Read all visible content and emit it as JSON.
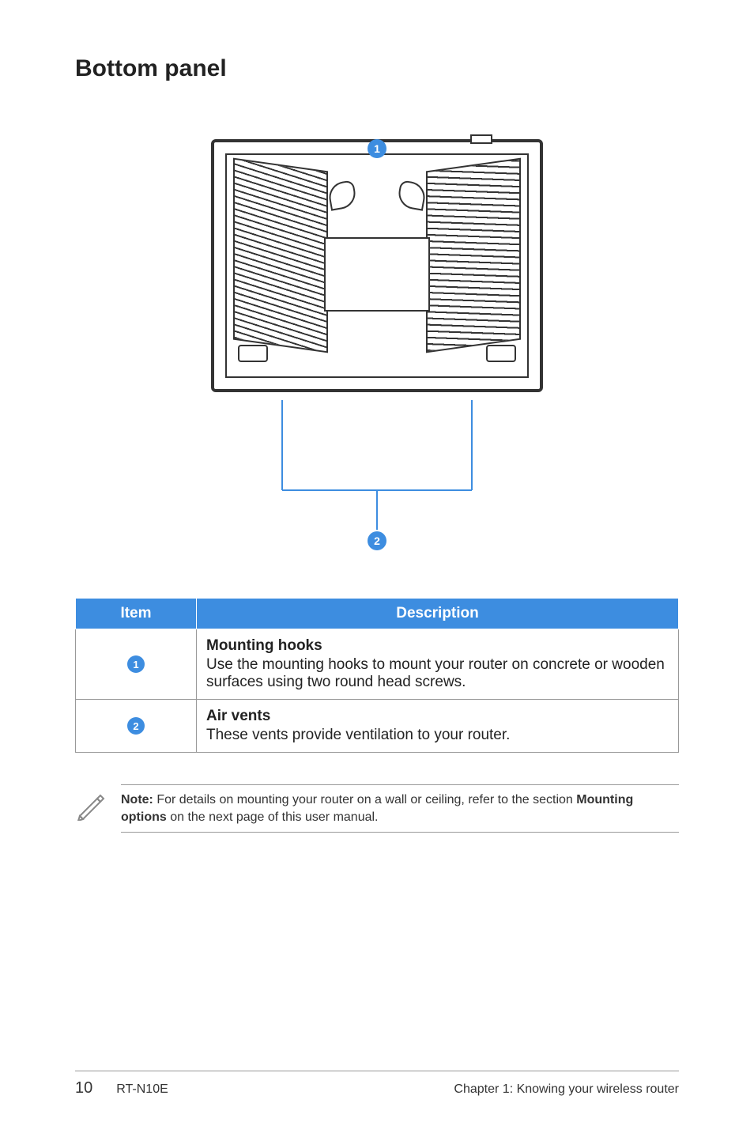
{
  "heading": "Bottom panel",
  "diagram": {
    "callouts": [
      {
        "num": "1",
        "label": "Mounting hooks"
      },
      {
        "num": "2",
        "label": "Air vents"
      }
    ]
  },
  "table": {
    "headers": {
      "item": "Item",
      "description": "Description"
    },
    "rows": [
      {
        "num": "1",
        "title": "Mounting hooks",
        "body": "Use the mounting hooks to mount your router on concrete or wooden surfaces using two round head screws."
      },
      {
        "num": "2",
        "title": "Air vents",
        "body": "These vents provide ventilation to your router."
      }
    ]
  },
  "note": {
    "label": "Note:",
    "text_before": " For details on mounting your router on a wall or ceiling, refer to the section ",
    "bold_ref": "Mounting options",
    "text_after": " on the next page of this user manual."
  },
  "footer": {
    "page": "10",
    "model": "RT-N10E",
    "chapter": "Chapter 1: Knowing your wireless router"
  }
}
